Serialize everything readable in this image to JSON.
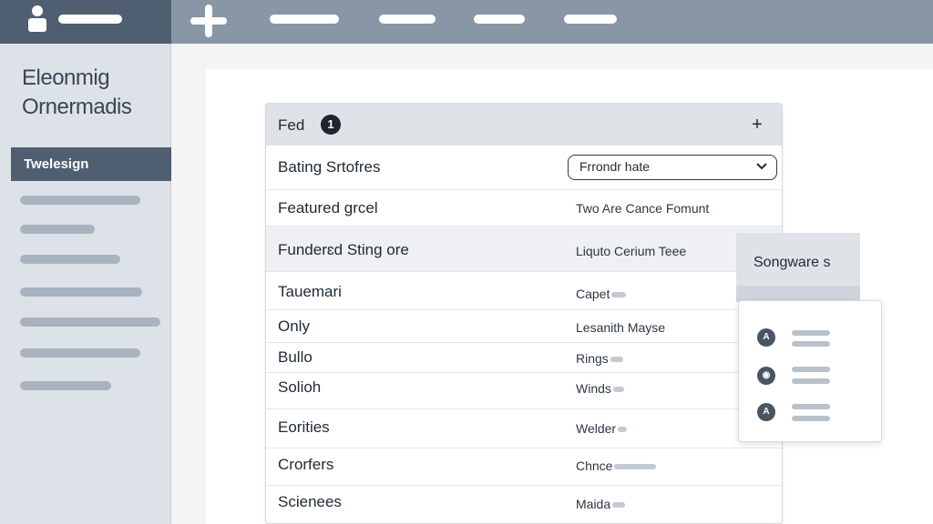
{
  "sidebar": {
    "brand_line1": "Eleonmig",
    "brand_line2": "Ornermadis",
    "active_item": "Twelesign"
  },
  "card": {
    "title": "Fed",
    "badge": "1",
    "add_label": "+",
    "select": {
      "label": "Bating Srtofres",
      "value": "Frrondr hate"
    },
    "rows": [
      {
        "label": "Featured grcel",
        "value": "Two Are Cance Fomunt"
      },
      {
        "label": "Funderɛd Sting ore",
        "value": "Liquto Cerium Teee"
      },
      {
        "label": "Tauemari",
        "value": "Capet"
      },
      {
        "label": "Only",
        "value": "Lesanith Mayse"
      },
      {
        "label": "Bullo",
        "value": "Rings"
      },
      {
        "label": "Solioh",
        "value": "Winds"
      },
      {
        "label": "Eorities",
        "value": "Welder"
      },
      {
        "label": "Crorfers",
        "value": "Chnce"
      },
      {
        "label": "Scienees",
        "value": "Maida"
      }
    ]
  },
  "popover": {
    "tab_label": "Songware s",
    "items": [
      {
        "icon": "A",
        "icon_name": "person-icon"
      },
      {
        "icon": "◉",
        "icon_name": "chat-icon"
      },
      {
        "icon": "A",
        "icon_name": "person-icon"
      }
    ]
  },
  "colors": {
    "topbar": "#8996a5",
    "topbar_dark": "#4f5e70",
    "sidebar": "#dde2e8",
    "active": "#4f5e70"
  }
}
